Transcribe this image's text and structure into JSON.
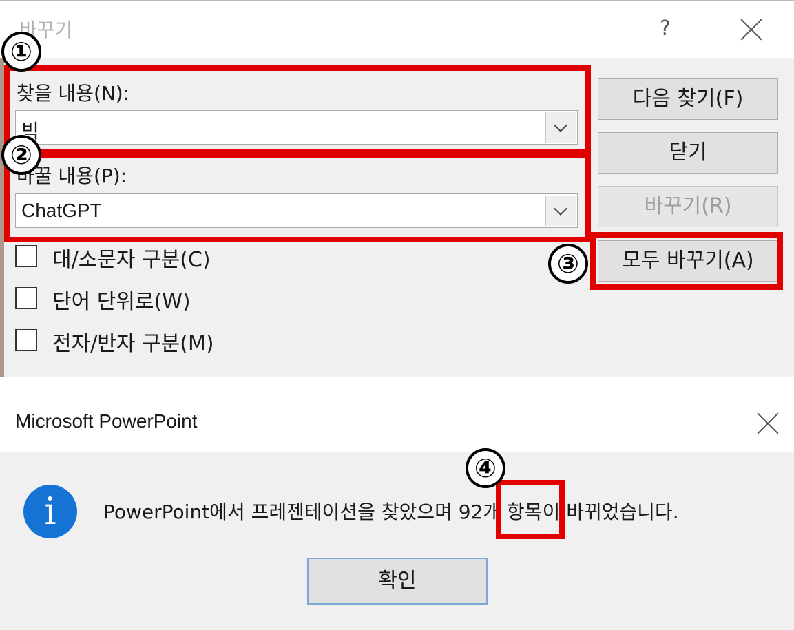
{
  "replace_dialog": {
    "title": "바꾸기",
    "help_label": "?",
    "find": {
      "label": "찾을 내용(N):",
      "value": "빅"
    },
    "replace": {
      "label": "바꿀 내용(P):",
      "value": "ChatGPT"
    },
    "buttons": {
      "find_next": "다음 찾기(F)",
      "close": "닫기",
      "replace": "바꾸기(R)",
      "replace_all": "모두 바꾸기(A)"
    },
    "options": [
      {
        "label": "대/소문자 구분(C)",
        "checked": false
      },
      {
        "label": "단어 단위로(W)",
        "checked": false
      },
      {
        "label": "전자/반자 구분(M)",
        "checked": false
      }
    ]
  },
  "message_box": {
    "title": "Microsoft PowerPoint",
    "message": "PowerPoint에서 프레젠테이션을 찾았으며 92개 항목이 바뀌었습니다.",
    "ok_label": "확인",
    "icon": "info-icon"
  },
  "annotations": {
    "markers": [
      "①",
      "②",
      "③",
      "④"
    ],
    "highlight_color": "#e00000"
  }
}
